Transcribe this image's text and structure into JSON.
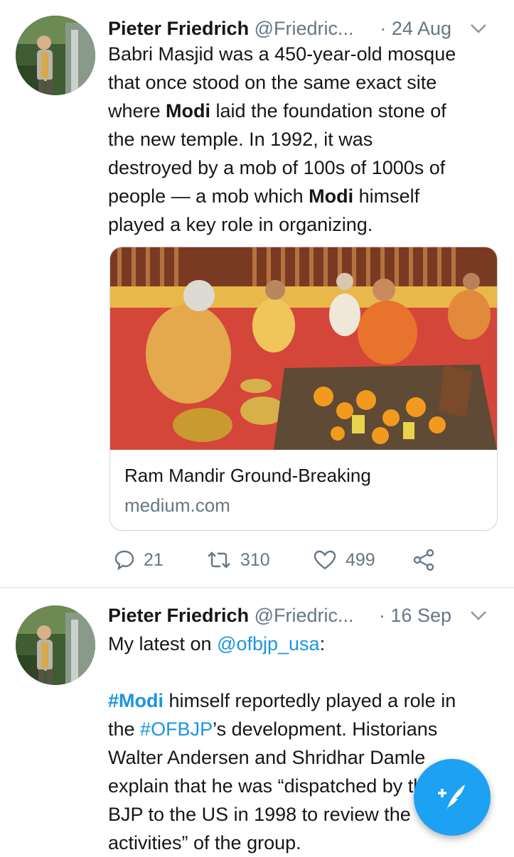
{
  "tweets": [
    {
      "author_name": "Pieter Friedrich",
      "handle": "@Friedric...",
      "time": "· 24 Aug",
      "text": {
        "l1": "Babri Masjid was a 450-year-old mosque",
        "l2": "that once stood on the same exact site",
        "l3a": "where ",
        "l3b": "Modi",
        "l3c": " laid the foundation stone of",
        "l4": "the new temple. In 1992, it was",
        "l5": "destroyed by a mob of 100s of 1000s of",
        "l6a": "people — a mob which ",
        "l6b": "Modi",
        "l6c": " himself",
        "l7": "played a key role in organizing."
      },
      "card": {
        "title": "Ram Mandir Ground-Breaking",
        "domain": "medium.com"
      },
      "actions": {
        "replies": "21",
        "retweets": "310",
        "likes": "499"
      }
    },
    {
      "author_name": "Pieter Friedrich",
      "handle": "@Friedric...",
      "time": "· 16 Sep",
      "text": {
        "l1a": "My latest on ",
        "l1b": "@ofbjp_usa",
        "l1c": ":",
        "l3a": "#Modi",
        "l3b": " himself reportedly played a role in",
        "l4a": "the ",
        "l4b": "#OFBJP",
        "l4c": "’s development. Historians",
        "l5": "Walter Andersen and Shridhar Damle",
        "l6": "explain that he was “dispatched by the",
        "l7": "BJP to the US in 1998 to review the",
        "l8": "activities” of the group."
      }
    }
  ],
  "colors": {
    "accent": "#1da1f2",
    "link": "#1b95e0",
    "muted": "#657786"
  },
  "icons": {
    "reply": "speech-bubble",
    "retweet": "retweet-arrows",
    "like": "heart",
    "share": "share-nodes",
    "compose": "feather-plus"
  }
}
